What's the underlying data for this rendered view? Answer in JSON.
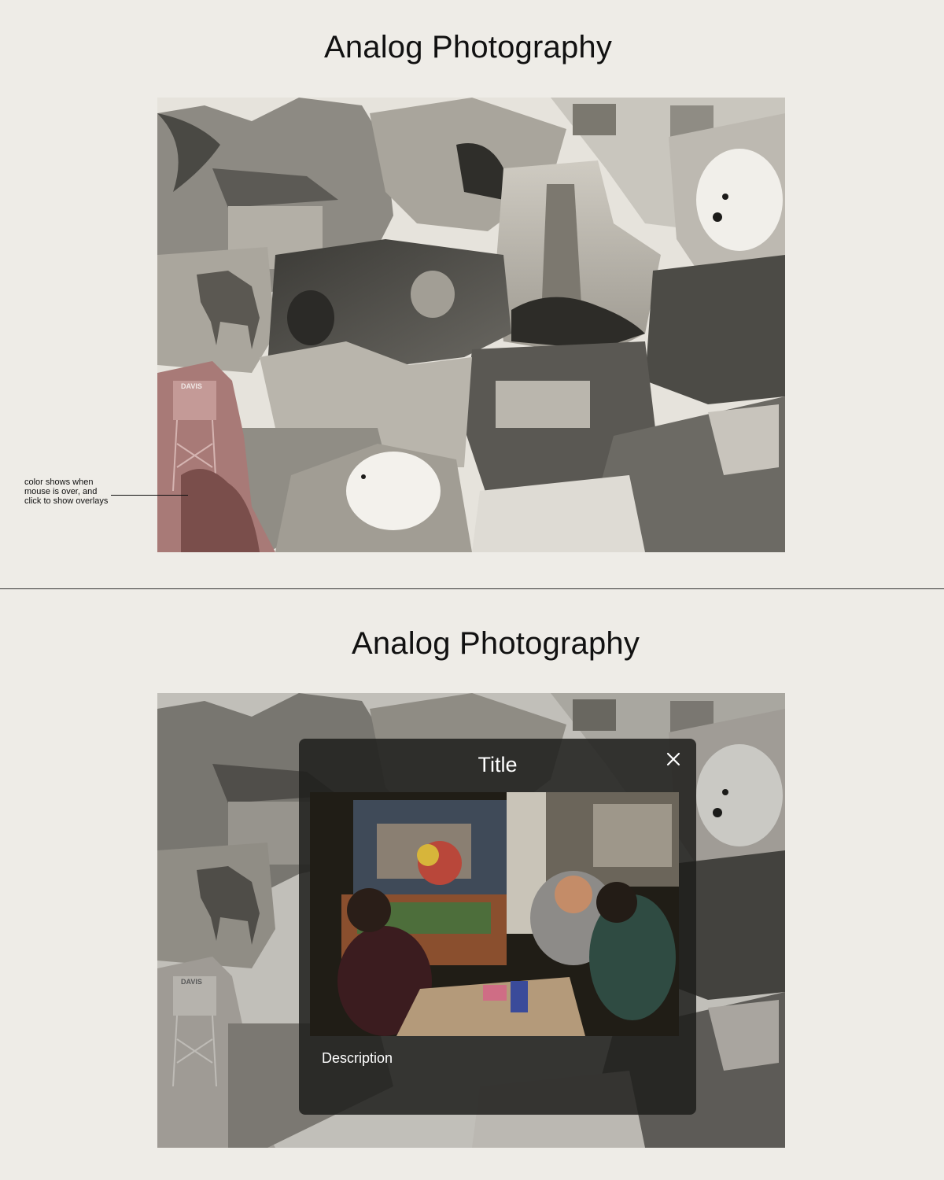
{
  "top_section": {
    "title": "Analog Photography",
    "annotation": "color shows when mouse is over, and click to show overlays",
    "tower_sign": "DAVIS"
  },
  "bottom_section": {
    "title": "Analog Photography",
    "tower_sign": "DAVIS",
    "modal": {
      "title": "Title",
      "description": "Description",
      "close_icon": "close-icon"
    }
  },
  "colors": {
    "background": "#eeece7",
    "highlight_tint": "#a87a77",
    "modal_bg": "#1e1e1c"
  }
}
